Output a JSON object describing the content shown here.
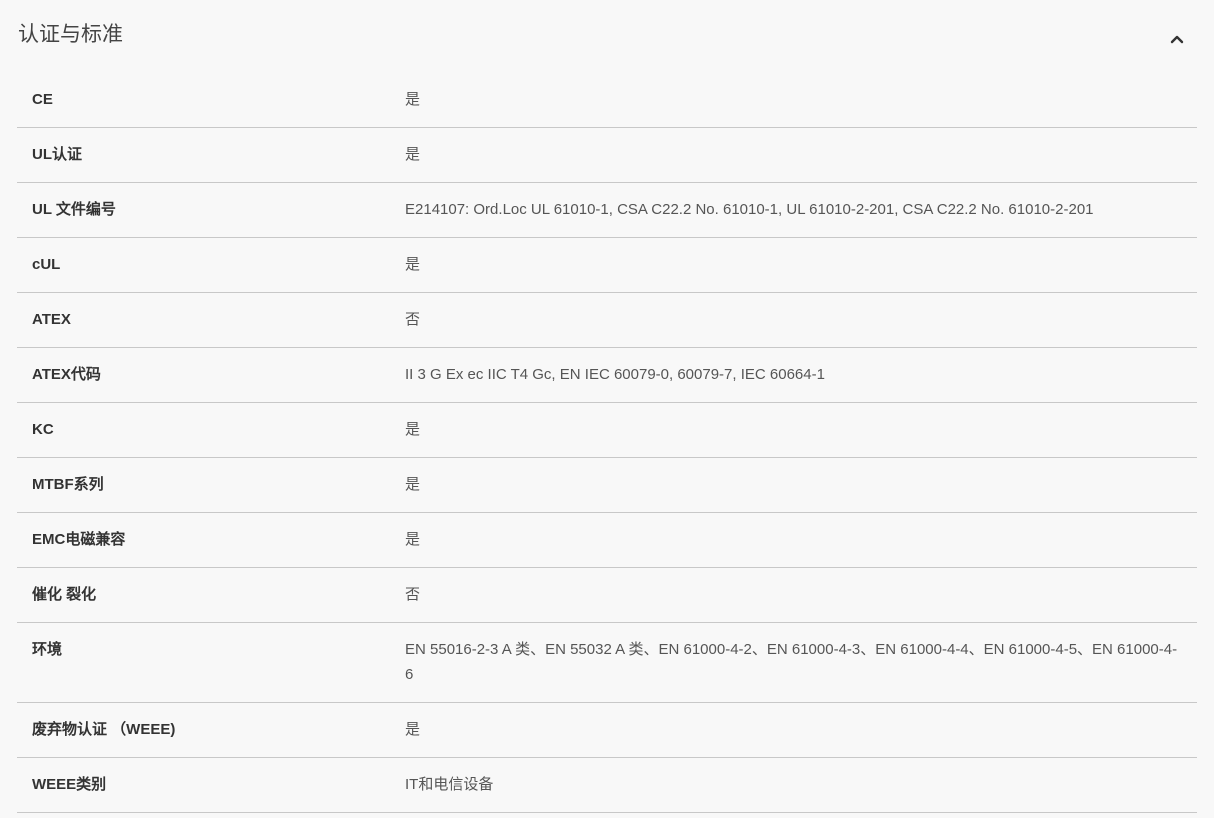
{
  "section": {
    "title": "认证与标准",
    "collapse_icon": "chevron-up-icon"
  },
  "rows": [
    {
      "label": "CE",
      "value": "是"
    },
    {
      "label": "UL认证",
      "value": "是"
    },
    {
      "label": "UL 文件编号",
      "value": "E214107: Ord.Loc UL 61010-1, CSA C22.2 No. 61010-1, UL 61010-2-201, CSA C22.2 No. 61010-2-201"
    },
    {
      "label": "cUL",
      "value": "是"
    },
    {
      "label": "ATEX",
      "value": "否"
    },
    {
      "label": "ATEX代码",
      "value": "II 3 G Ex ec IIC T4 Gc, EN IEC 60079-0, 60079-7, IEC 60664-1"
    },
    {
      "label": "KC",
      "value": "是"
    },
    {
      "label": "MTBF系列",
      "value": "是"
    },
    {
      "label": "EMC电磁兼容",
      "value": "是"
    },
    {
      "label": "催化 裂化",
      "value": "否"
    },
    {
      "label": "环境",
      "value": "EN 55016-2-3 A 类、EN 55032 A 类、EN 61000-4-2、EN 61000-4-3、EN 61000-4-4、EN 61000-4-5、EN 61000-4-6"
    },
    {
      "label": "废弃物认证 （WEEE)",
      "value": "是"
    },
    {
      "label": "WEEE类别",
      "value": "IT和电信设备"
    }
  ]
}
